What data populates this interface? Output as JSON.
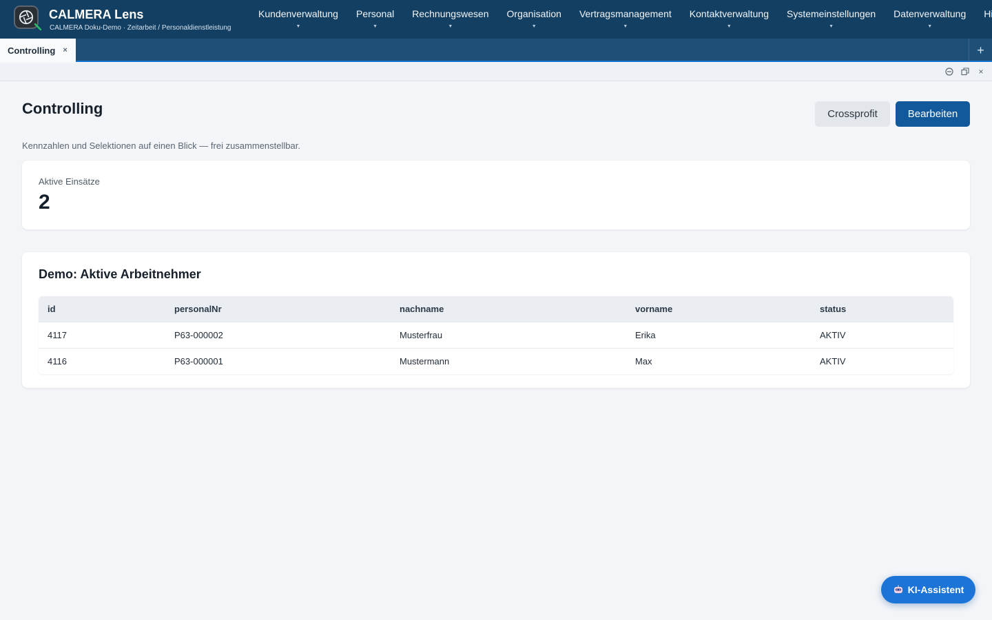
{
  "app": {
    "title": "CALMERA Lens",
    "subtitle": "CALMERA Doku-Demo · Zeitarbeit / Personaldienstleistung",
    "logo_icon": "calmera-lens-logo"
  },
  "nav": {
    "items": [
      {
        "label": "Kundenverwaltung"
      },
      {
        "label": "Personal"
      },
      {
        "label": "Rechnungswesen"
      },
      {
        "label": "Organisation"
      },
      {
        "label": "Vertragsmanagement"
      },
      {
        "label": "Kontaktverwaltung"
      },
      {
        "label": "Systemeinstellungen"
      },
      {
        "label": "Datenverwaltung"
      },
      {
        "label": "Hilfebe"
      }
    ]
  },
  "tabs": {
    "items": [
      {
        "label": "Controlling",
        "close": "×"
      }
    ],
    "add_label": "+"
  },
  "window_controls": {
    "minimize_icon": "minimize-icon",
    "restore_icon": "restore-icon",
    "close_label": "×"
  },
  "page": {
    "title": "Controlling",
    "description": "Kennzahlen und Selektionen auf einen Blick — frei zusammenstellbar.",
    "buttons": {
      "crossprofit": "Crossprofit",
      "edit": "Bearbeiten"
    }
  },
  "kpi": {
    "label": "Aktive Einsätze",
    "value": "2"
  },
  "table": {
    "title": "Demo: Aktive Arbeitnehmer",
    "columns": [
      "id",
      "personalNr",
      "nachname",
      "vorname",
      "status"
    ],
    "rows": [
      [
        "4117",
        "P63-000002",
        "Musterfrau",
        "Erika",
        "AKTIV"
      ],
      [
        "4116",
        "P63-000001",
        "Mustermann",
        "Max",
        "AKTIV"
      ]
    ]
  },
  "assistant": {
    "label": "KI-Assistent",
    "icon": "robot-icon"
  },
  "colors": {
    "header_bg": "#123f62",
    "tabbar_bg": "#1d4f77",
    "primary": "#12599b",
    "fab": "#1b74d6"
  }
}
